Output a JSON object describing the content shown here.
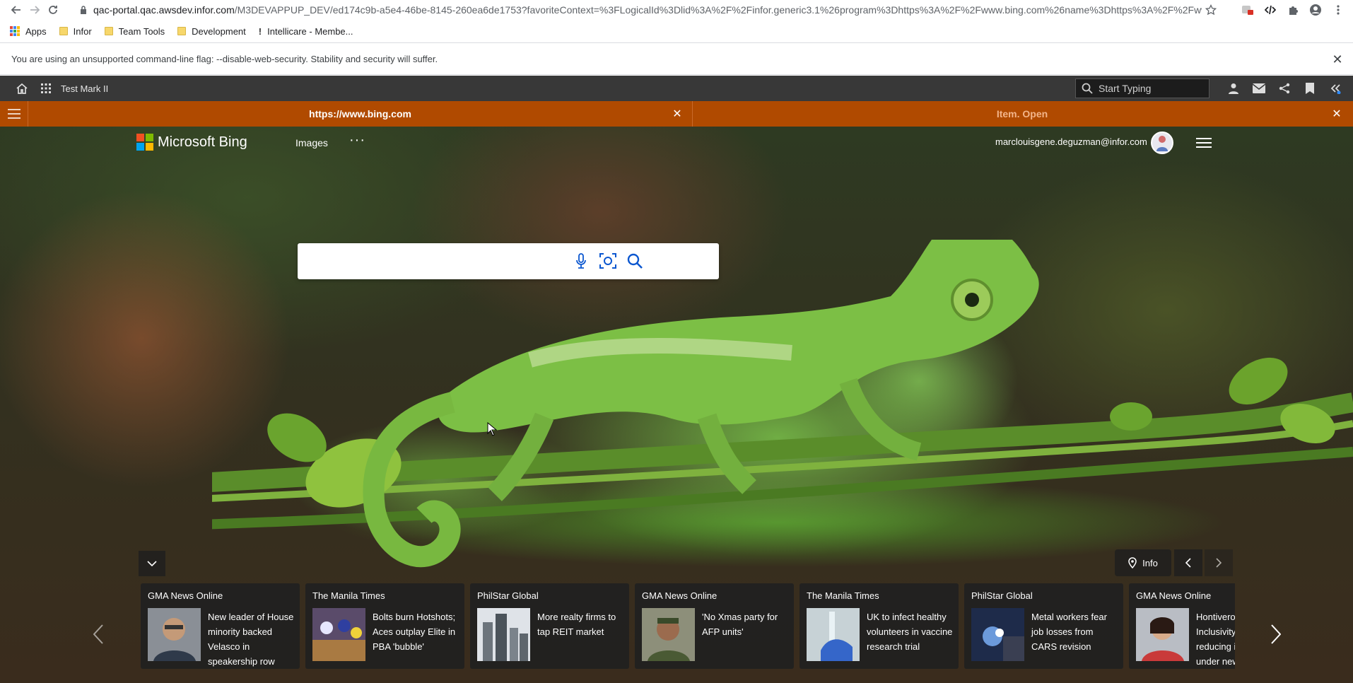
{
  "browser": {
    "url_host": "qac-portal.qac.awsdev.infor.com",
    "url_path": "/M3DEVAPPUP_DEV/ed174c9b-a5e4-46be-8145-260ea6de1753?favoriteContext=%3FLogicalId%3Dlid%3A%2F%2Finfor.generic3.1%26program%3Dhttps%3A%2F%2Fwww.bing.com%26name%3Dhttps%3A%2F%2Fwww....",
    "bookmarks": [
      {
        "label": "Apps"
      },
      {
        "label": "Infor"
      },
      {
        "label": "Team Tools"
      },
      {
        "label": "Development"
      },
      {
        "label": "Intellicare - Membe..."
      }
    ],
    "warning": "You are using an unsupported command-line flag: --disable-web-security. Stability and security will suffer."
  },
  "portal": {
    "title": "Test Mark II",
    "search_placeholder": "Start Typing"
  },
  "tabs": [
    {
      "label": "https://www.bing.com",
      "active": true
    },
    {
      "label": "Item. Open",
      "active": false
    }
  ],
  "bing": {
    "brand": "Microsoft Bing",
    "nav_images": "Images",
    "nav_more": "···",
    "account": "marclouisgene.deguzman@infor.com",
    "search_value": "",
    "info_label": "Info",
    "news": [
      {
        "source": "GMA News Online",
        "headline": "New leader of House minority backed Velasco in speakership row",
        "thumb": "portrait"
      },
      {
        "source": "The Manila Times",
        "headline": "Bolts burn Hotshots; Aces outplay Elite in PBA 'bubble'",
        "thumb": "basketball"
      },
      {
        "source": "PhilStar Global",
        "headline": "More realty firms to tap REIT market",
        "thumb": "city"
      },
      {
        "source": "GMA News Online",
        "headline": "'No Xmas party for AFP units'",
        "thumb": "officer"
      },
      {
        "source": "The Manila Times",
        "headline": "UK to infect healthy volunteers in vaccine research trial",
        "thumb": "vaccine"
      },
      {
        "source": "PhilStar Global",
        "headline": "Metal workers fear job losses from CARS revision",
        "thumb": "welding"
      },
      {
        "source": "GMA News Online",
        "headline": "Hontiveros: Inclusivity key to reducing inequality under new normal",
        "thumb": "senator"
      }
    ]
  },
  "colors": {
    "portal_bg": "#383838",
    "tab_bar": "#b04a00"
  }
}
